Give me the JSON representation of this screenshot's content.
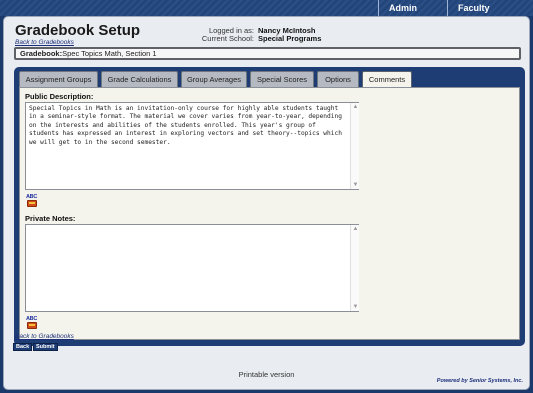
{
  "topnav": {
    "items": [
      "Admin",
      "Faculty"
    ]
  },
  "header": {
    "title": "Gradebook Setup",
    "back_link": "Back to Gradebooks",
    "logged_in_label": "Logged in as:",
    "logged_in_value": "Nancy McIntosh",
    "school_label": "Current School:",
    "school_value": "Special Programs"
  },
  "gradebook": {
    "label": "Gradebook:",
    "name": "Spec Topics Math, Section 1"
  },
  "tabs": [
    {
      "label": "Assignment Groups",
      "active": false
    },
    {
      "label": "Grade Calculations",
      "active": false
    },
    {
      "label": "Group Averages",
      "active": false
    },
    {
      "label": "Special Scores",
      "active": false
    },
    {
      "label": "Options",
      "active": false
    },
    {
      "label": "Comments",
      "active": true
    }
  ],
  "comments": {
    "public_label": "Public Description:",
    "public_text": "Special Topics in Math is an invitation-only course for highly able students taught in a seminar-style format. The material we cover varies from year-to-year, depending on the interests and abilities of the students enrolled. This year's group of students has expressed an interest in exploring vectors and set theory--topics which we will get to in the second semester.",
    "private_label": "Private Notes:",
    "private_text": ""
  },
  "icons": {
    "spellcheck": "spellcheck-icon",
    "spellcheck_text": "ABC"
  },
  "footer": {
    "back_link": "Back to Gradebooks",
    "back_button": "Back",
    "submit_button": "Submit",
    "printable": "Printable version",
    "powered": "Powered by Senior Systems, Inc."
  },
  "colors": {
    "navy": "#1f3d75",
    "tab_bg": "#b5bac2",
    "content_bg": "#f4f4ec",
    "link": "#1c2e7a"
  }
}
